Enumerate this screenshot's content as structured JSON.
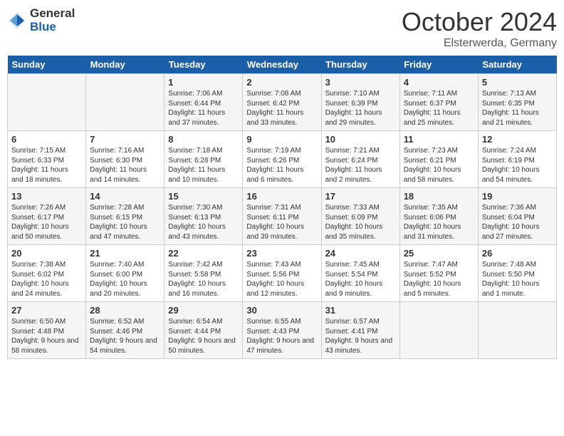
{
  "header": {
    "logo_general": "General",
    "logo_blue": "Blue",
    "month_title": "October 2024",
    "subtitle": "Elsterwerda, Germany"
  },
  "weekdays": [
    "Sunday",
    "Monday",
    "Tuesday",
    "Wednesday",
    "Thursday",
    "Friday",
    "Saturday"
  ],
  "weeks": [
    [
      {
        "day": "",
        "info": ""
      },
      {
        "day": "",
        "info": ""
      },
      {
        "day": "1",
        "info": "Sunrise: 7:06 AM\nSunset: 6:44 PM\nDaylight: 11 hours and 37 minutes."
      },
      {
        "day": "2",
        "info": "Sunrise: 7:08 AM\nSunset: 6:42 PM\nDaylight: 11 hours and 33 minutes."
      },
      {
        "day": "3",
        "info": "Sunrise: 7:10 AM\nSunset: 6:39 PM\nDaylight: 11 hours and 29 minutes."
      },
      {
        "day": "4",
        "info": "Sunrise: 7:11 AM\nSunset: 6:37 PM\nDaylight: 11 hours and 25 minutes."
      },
      {
        "day": "5",
        "info": "Sunrise: 7:13 AM\nSunset: 6:35 PM\nDaylight: 11 hours and 21 minutes."
      }
    ],
    [
      {
        "day": "6",
        "info": "Sunrise: 7:15 AM\nSunset: 6:33 PM\nDaylight: 11 hours and 18 minutes."
      },
      {
        "day": "7",
        "info": "Sunrise: 7:16 AM\nSunset: 6:30 PM\nDaylight: 11 hours and 14 minutes."
      },
      {
        "day": "8",
        "info": "Sunrise: 7:18 AM\nSunset: 6:28 PM\nDaylight: 11 hours and 10 minutes."
      },
      {
        "day": "9",
        "info": "Sunrise: 7:19 AM\nSunset: 6:26 PM\nDaylight: 11 hours and 6 minutes."
      },
      {
        "day": "10",
        "info": "Sunrise: 7:21 AM\nSunset: 6:24 PM\nDaylight: 11 hours and 2 minutes."
      },
      {
        "day": "11",
        "info": "Sunrise: 7:23 AM\nSunset: 6:21 PM\nDaylight: 10 hours and 58 minutes."
      },
      {
        "day": "12",
        "info": "Sunrise: 7:24 AM\nSunset: 6:19 PM\nDaylight: 10 hours and 54 minutes."
      }
    ],
    [
      {
        "day": "13",
        "info": "Sunrise: 7:26 AM\nSunset: 6:17 PM\nDaylight: 10 hours and 50 minutes."
      },
      {
        "day": "14",
        "info": "Sunrise: 7:28 AM\nSunset: 6:15 PM\nDaylight: 10 hours and 47 minutes."
      },
      {
        "day": "15",
        "info": "Sunrise: 7:30 AM\nSunset: 6:13 PM\nDaylight: 10 hours and 43 minutes."
      },
      {
        "day": "16",
        "info": "Sunrise: 7:31 AM\nSunset: 6:11 PM\nDaylight: 10 hours and 39 minutes."
      },
      {
        "day": "17",
        "info": "Sunrise: 7:33 AM\nSunset: 6:09 PM\nDaylight: 10 hours and 35 minutes."
      },
      {
        "day": "18",
        "info": "Sunrise: 7:35 AM\nSunset: 6:06 PM\nDaylight: 10 hours and 31 minutes."
      },
      {
        "day": "19",
        "info": "Sunrise: 7:36 AM\nSunset: 6:04 PM\nDaylight: 10 hours and 27 minutes."
      }
    ],
    [
      {
        "day": "20",
        "info": "Sunrise: 7:38 AM\nSunset: 6:02 PM\nDaylight: 10 hours and 24 minutes."
      },
      {
        "day": "21",
        "info": "Sunrise: 7:40 AM\nSunset: 6:00 PM\nDaylight: 10 hours and 20 minutes."
      },
      {
        "day": "22",
        "info": "Sunrise: 7:42 AM\nSunset: 5:58 PM\nDaylight: 10 hours and 16 minutes."
      },
      {
        "day": "23",
        "info": "Sunrise: 7:43 AM\nSunset: 5:56 PM\nDaylight: 10 hours and 12 minutes."
      },
      {
        "day": "24",
        "info": "Sunrise: 7:45 AM\nSunset: 5:54 PM\nDaylight: 10 hours and 9 minutes."
      },
      {
        "day": "25",
        "info": "Sunrise: 7:47 AM\nSunset: 5:52 PM\nDaylight: 10 hours and 5 minutes."
      },
      {
        "day": "26",
        "info": "Sunrise: 7:48 AM\nSunset: 5:50 PM\nDaylight: 10 hours and 1 minute."
      }
    ],
    [
      {
        "day": "27",
        "info": "Sunrise: 6:50 AM\nSunset: 4:48 PM\nDaylight: 9 hours and 58 minutes."
      },
      {
        "day": "28",
        "info": "Sunrise: 6:52 AM\nSunset: 4:46 PM\nDaylight: 9 hours and 54 minutes."
      },
      {
        "day": "29",
        "info": "Sunrise: 6:54 AM\nSunset: 4:44 PM\nDaylight: 9 hours and 50 minutes."
      },
      {
        "day": "30",
        "info": "Sunrise: 6:55 AM\nSunset: 4:43 PM\nDaylight: 9 hours and 47 minutes."
      },
      {
        "day": "31",
        "info": "Sunrise: 6:57 AM\nSunset: 4:41 PM\nDaylight: 9 hours and 43 minutes."
      },
      {
        "day": "",
        "info": ""
      },
      {
        "day": "",
        "info": ""
      }
    ]
  ]
}
